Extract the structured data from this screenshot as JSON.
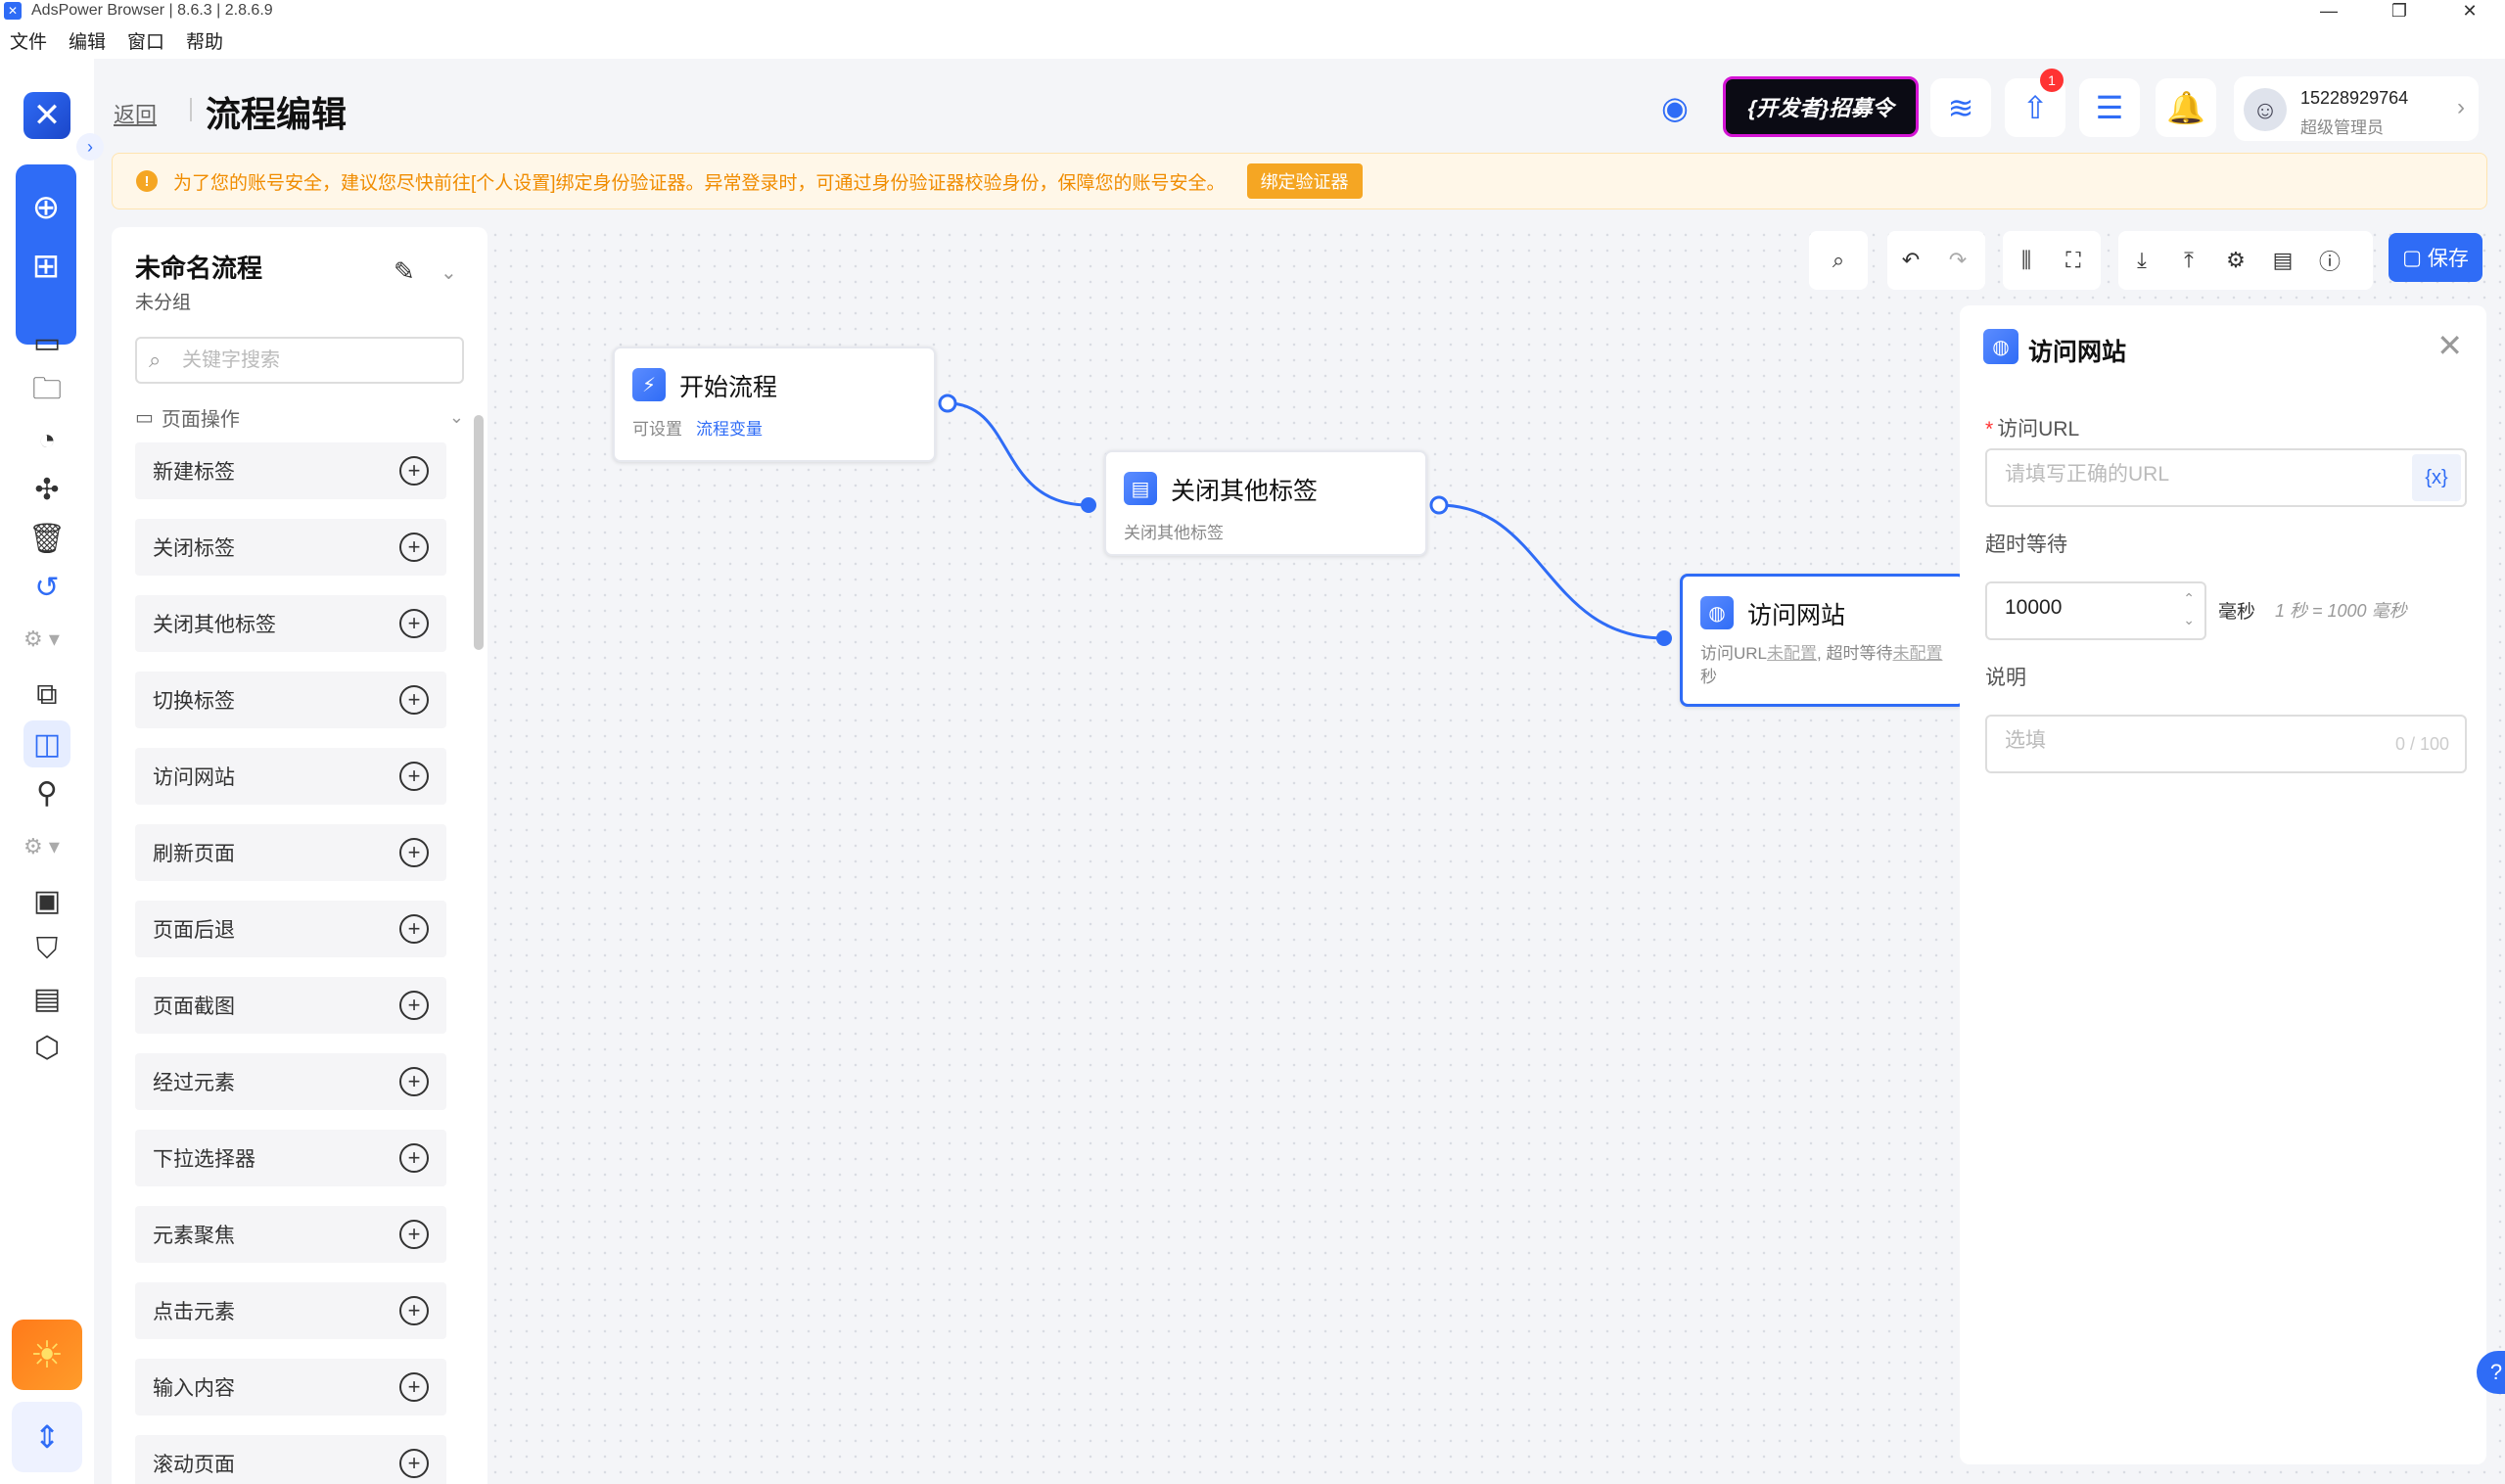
{
  "window": {
    "title": "AdsPower Browser | 8.6.3 | 2.8.6.9",
    "controls": [
      "—",
      "❐",
      "✕"
    ]
  },
  "menu": [
    "文件",
    "编辑",
    "窗口",
    "帮助"
  ],
  "header": {
    "back_label": "返回",
    "page_title": "流程编辑",
    "promo_text": "{开发者}招募令",
    "notification_badge": "1",
    "user": {
      "phone": "15228929764",
      "role": "超级管理员"
    }
  },
  "banner": {
    "message": "为了您的账号安全，建议您尽快前往[个人设置]绑定身份验证器。异常登录时，可通过身份验证器校验身份，保障您的账号安全。",
    "action_label": "绑定验证器"
  },
  "library": {
    "flow_name": "未命名流程",
    "flow_group": "未分组",
    "search_placeholder": "关键字搜索",
    "category_label": "页面操作",
    "items": [
      "新建标签",
      "关闭标签",
      "关闭其他标签",
      "切换标签",
      "访问网站",
      "刷新页面",
      "页面后退",
      "页面截图",
      "经过元素",
      "下拉选择器",
      "元素聚焦",
      "点击元素",
      "输入内容",
      "滚动页面"
    ]
  },
  "toolbar": {
    "save_label": "保存"
  },
  "nodes": {
    "start": {
      "title": "开始流程",
      "sub": "可设置",
      "link": "流程变量"
    },
    "close_others": {
      "title": "关闭其他标签",
      "sub": "关闭其他标签"
    },
    "visit": {
      "title": "访问网站",
      "sub_prefix": "访问URL",
      "sub_unset1": "未配置",
      "sub_mid": ", 超时等待",
      "sub_unset2": "未配置",
      "sub_line2": "秒"
    }
  },
  "props": {
    "title": "访问网站",
    "url_label": "访问URL",
    "url_placeholder": "请填写正确的URL",
    "var_button": "{x}",
    "timeout_label": "超时等待",
    "timeout_value": "10000",
    "timeout_unit": "毫秒",
    "timeout_hint": "1 秒 = 1000 毫秒",
    "desc_label": "说明",
    "desc_placeholder": "选填",
    "desc_counter": "0 / 100"
  },
  "colors": {
    "accent": "#2f6cf6",
    "warning": "#f5a623",
    "promo_border": "#d414d4"
  }
}
